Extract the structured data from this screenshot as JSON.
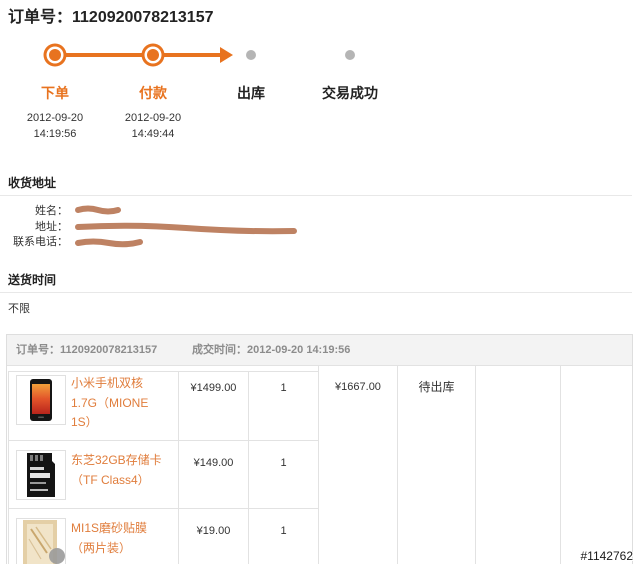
{
  "title": "订单号：1120920078213157",
  "progress": {
    "completed_steps": 2,
    "steps": [
      {
        "label": "下单",
        "date": "2012-09-20",
        "time": "14:19:56"
      },
      {
        "label": "付款",
        "date": "2012-09-20",
        "time": "14:49:44"
      },
      {
        "label": "出库"
      },
      {
        "label": "交易成功"
      }
    ]
  },
  "shipping_address": {
    "heading": "收货地址",
    "name_label": "姓名：",
    "address_label": "地址：",
    "phone_label": "联系电话："
  },
  "delivery_time": {
    "heading": "送货时间",
    "value": "不限"
  },
  "order_table": {
    "order_number": "订单号：1120920078213157",
    "deal_time": "成交时间：2012-09-20 14:19:56",
    "items": [
      {
        "name": "小米手机双核1.7G（MIONE 1S）",
        "price": "¥1499.00",
        "quantity": "1",
        "thumbnail_icon": "phone-thumbnail"
      },
      {
        "name": "东芝32GB存储卡（TF Class4）",
        "price": "¥149.00",
        "quantity": "1",
        "thumbnail_icon": "memory-card-thumbnail"
      },
      {
        "name": "MI1S磨砂贴膜（两片装）",
        "price": "¥19.00",
        "quantity": "1",
        "thumbnail_icon": "screen-film-thumbnail"
      }
    ],
    "total": "¥1667.00",
    "status": "待出库"
  },
  "watermark": "#1142762",
  "colors": {
    "accent": "#e8731f",
    "pending": "#b5b5b5",
    "link": "#e07d3c",
    "redaction": "#b87756"
  }
}
